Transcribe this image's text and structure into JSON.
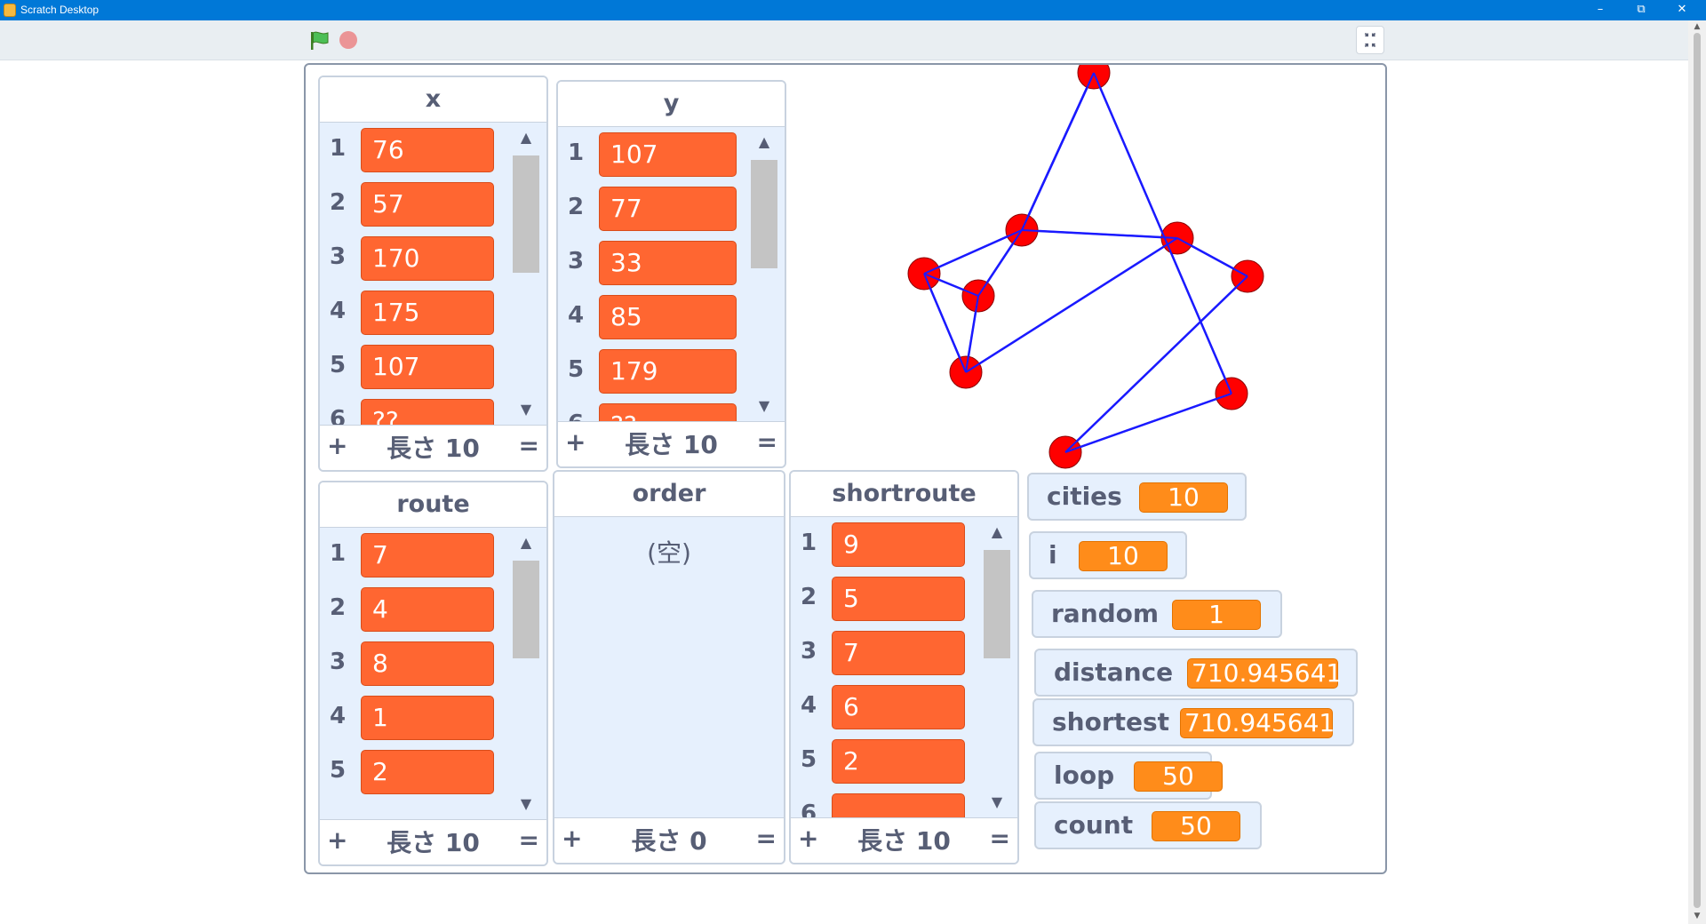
{
  "window": {
    "title": "Scratch Desktop"
  },
  "lists": {
    "x": {
      "name": "x",
      "items": [
        "76",
        "57",
        "170",
        "175",
        "107",
        "??"
      ],
      "indices": [
        "1",
        "2",
        "3",
        "4",
        "5",
        "6"
      ],
      "length_label": "長さ 10"
    },
    "y": {
      "name": "y",
      "items": [
        "107",
        "77",
        "33",
        "85",
        "179",
        "??"
      ],
      "indices": [
        "1",
        "2",
        "3",
        "4",
        "5",
        "6"
      ],
      "length_label": "長さ 10"
    },
    "route": {
      "name": "route",
      "items": [
        "7",
        "4",
        "8",
        "1",
        "2"
      ],
      "indices": [
        "1",
        "2",
        "3",
        "4",
        "5"
      ],
      "length_label": "長さ 10"
    },
    "order": {
      "name": "order",
      "empty_label": "(空)",
      "length_label": "長さ 0"
    },
    "shortroute": {
      "name": "shortroute",
      "items": [
        "9",
        "5",
        "7",
        "6",
        "2",
        ""
      ],
      "indices": [
        "1",
        "2",
        "3",
        "4",
        "5",
        "6"
      ],
      "length_label": "長さ 10"
    }
  },
  "footer": {
    "plus": "+",
    "equals": "="
  },
  "variables": {
    "cities": {
      "label": "cities",
      "value": "10"
    },
    "i": {
      "label": "i",
      "value": "10"
    },
    "random": {
      "label": "random",
      "value": "1"
    },
    "distance": {
      "label": "distance",
      "value": "710.945641"
    },
    "shortest": {
      "label": "shortest",
      "value": "710.945641"
    },
    "loop": {
      "label": "loop",
      "value": "50"
    },
    "count": {
      "label": "count",
      "value": "50"
    }
  },
  "graph": {
    "node_color": "#ff0000",
    "edge_color": "#1a1aff",
    "visible_route_points": 11
  }
}
